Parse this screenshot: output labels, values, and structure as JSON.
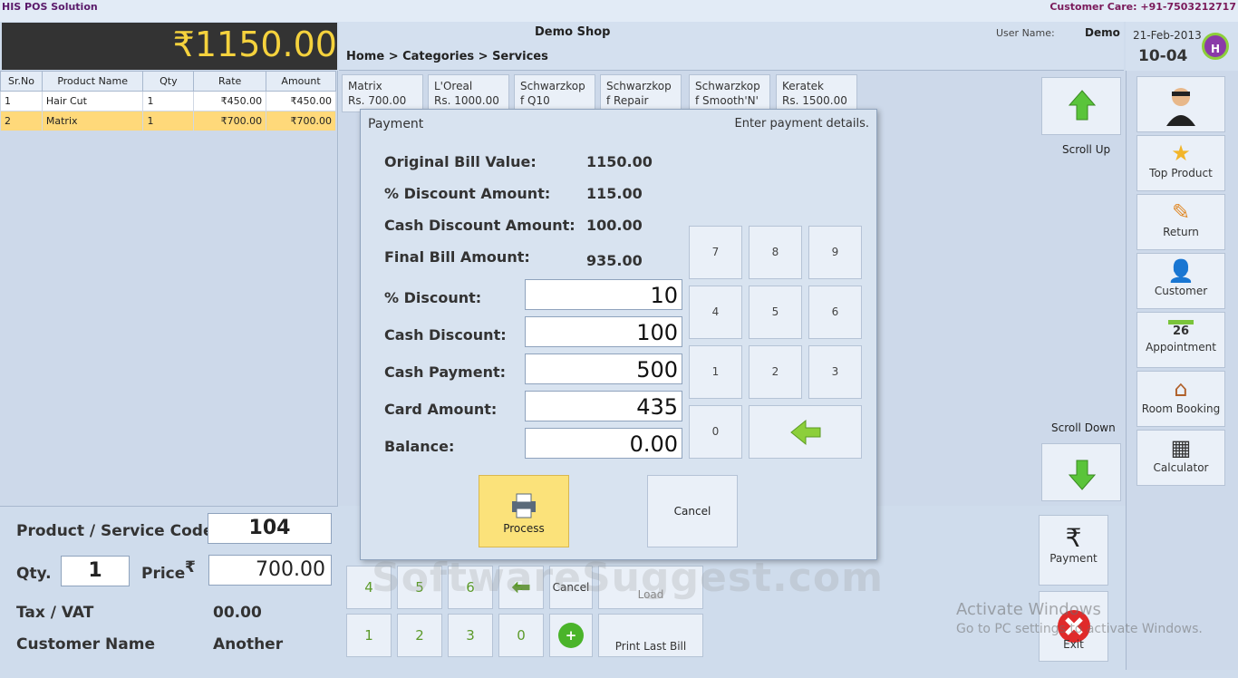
{
  "app": {
    "title": "HIS POS Solution",
    "customer_care": "Customer Care: +91-7503212717"
  },
  "total": "₹1150.00",
  "header": {
    "shop": "Demo Shop",
    "breadcrumb": "Home > Categories > Services",
    "user_label": "User Name:",
    "user_value": "Demo",
    "date": "21-Feb-2013",
    "time": "10-04",
    "logo_letter": "H"
  },
  "cart": {
    "columns": [
      "Sr.No",
      "Product Name",
      "Qty",
      "Rate",
      "Amount"
    ],
    "rows": [
      {
        "sr": "1",
        "name": "Hair Cut",
        "qty": "1",
        "rate": "₹450.00",
        "amount": "₹450.00"
      },
      {
        "sr": "2",
        "name": "Matrix",
        "qty": "1",
        "rate": "₹700.00",
        "amount": "₹700.00"
      }
    ]
  },
  "products": [
    "Matrix",
    "L'Oreal",
    "Schwarzkop f Q10",
    "Schwarzkop f Repair",
    "Schwarzkop f Smooth'N'",
    "Keratek"
  ],
  "product_prices": [
    "Rs. 700.00",
    "Rs. 1000.00",
    "",
    "",
    "",
    "Rs. 1500.00"
  ],
  "entry": {
    "code_label": "Product / Service Code",
    "code_value": "104",
    "qty_label": "Qty.",
    "qty_value": "1",
    "price_label": "Price",
    "price_symbol": "₹",
    "price_value": "700.00",
    "tax_label": "Tax / VAT",
    "tax_value": "00.00",
    "customer_label": "Customer Name",
    "customer_value": "Another"
  },
  "scroll": {
    "up": "Scroll Up",
    "down": "Scroll Down"
  },
  "side": {
    "top_product": "Top Product",
    "return": "Return",
    "customer": "Customer",
    "appointment": "Appointment",
    "appointment_day": "26",
    "room_booking": "Room Booking",
    "calculator": "Calculator",
    "payment": "Payment",
    "exit": "Exit"
  },
  "bottom_keys": {
    "k4": "4",
    "k5": "5",
    "k6": "6",
    "cancel": "Cancel",
    "load": "Load",
    "k1": "1",
    "k2": "2",
    "k3": "3",
    "k0": "0",
    "print_last_bill": "Print Last Bill"
  },
  "dialog": {
    "title": "Payment",
    "hint": "Enter payment details.",
    "orig_label": "Original Bill Value:",
    "orig_value": "1150.00",
    "pct_amt_label": "% Discount Amount:",
    "pct_amt_value": "115.00",
    "cash_amt_label": "Cash Discount Amount:",
    "cash_amt_value": "100.00",
    "final_label": "Final Bill Amount:",
    "final_value": "935.00",
    "pct_label": "% Discount:",
    "pct_value": "10",
    "cash_label": "Cash Discount:",
    "cash_value": "100",
    "cashpay_label": "Cash Payment:",
    "cashpay_value": "500",
    "card_label": "Card Amount:",
    "card_value": "435",
    "balance_label": "Balance:",
    "balance_value": "0.00",
    "keys": [
      "7",
      "8",
      "9",
      "4",
      "5",
      "6",
      "1",
      "2",
      "3",
      "0"
    ],
    "process": "Process",
    "cancel": "Cancel"
  },
  "watermark": "SoftwareSuggest.com",
  "activate": {
    "title": "Activate Windows",
    "sub": "Go to PC settings to activate Windows."
  }
}
